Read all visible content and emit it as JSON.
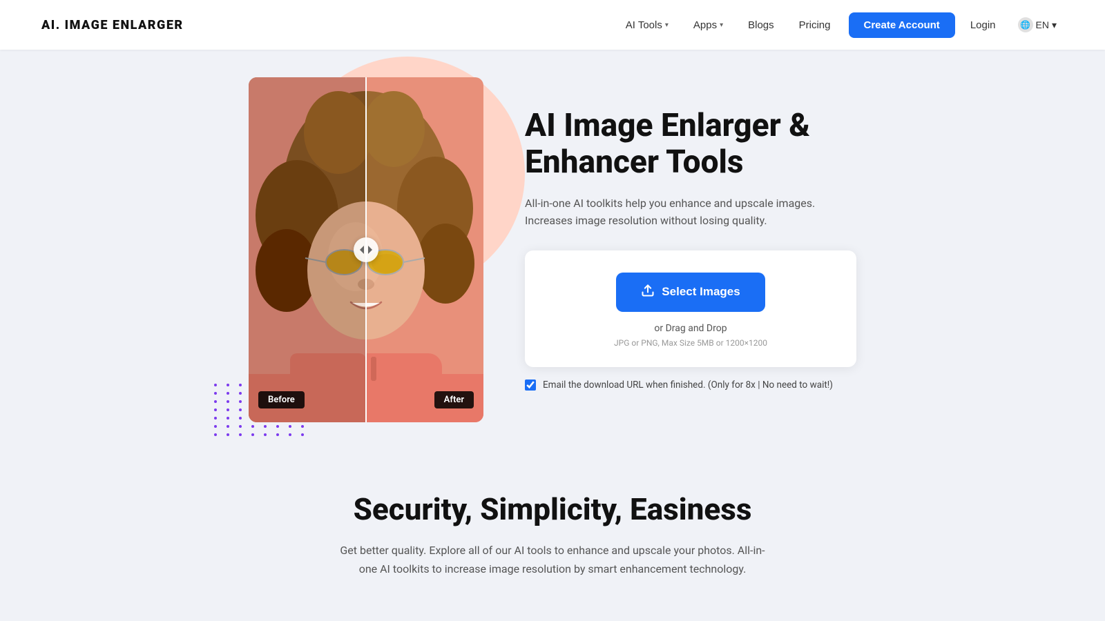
{
  "brand": {
    "logo": "AI. IMAGE ENLARGER"
  },
  "nav": {
    "ai_tools": "AI Tools",
    "apps": "Apps",
    "blogs": "Blogs",
    "pricing": "Pricing",
    "create_account": "Create Account",
    "login": "Login",
    "lang_code": "EN"
  },
  "hero": {
    "title": "AI Image Enlarger & Enhancer Tools",
    "subtitle": "All-in-one AI toolkits help you enhance and upscale images. Increases image resolution without losing quality.",
    "before_label": "Before",
    "after_label": "After",
    "upload": {
      "select_button": "Select Images",
      "drag_drop": "or Drag and Drop",
      "file_info": "JPG or PNG, Max Size 5MB or 1200×1200",
      "email_checkbox_label": "Email the download URL when finished. (Only for 8x | No need to wait!)",
      "email_checked": true
    }
  },
  "features": {
    "title": "Security, Simplicity, Easiness",
    "subtitle": "Get better quality. Explore all of our AI tools to enhance and upscale your photos. All-in-one AI toolkits to increase image resolution by smart enhancement technology."
  },
  "icons": {
    "chevron_down": "▾",
    "upload_arrow": "↑",
    "handle_arrows": "◁▷",
    "globe": "🌐"
  },
  "colors": {
    "accent_blue": "#1a6ef5",
    "brand_purple": "#7c3aed",
    "pink_circle": "#ffd5c8",
    "text_dark": "#111111",
    "text_muted": "#555555"
  }
}
